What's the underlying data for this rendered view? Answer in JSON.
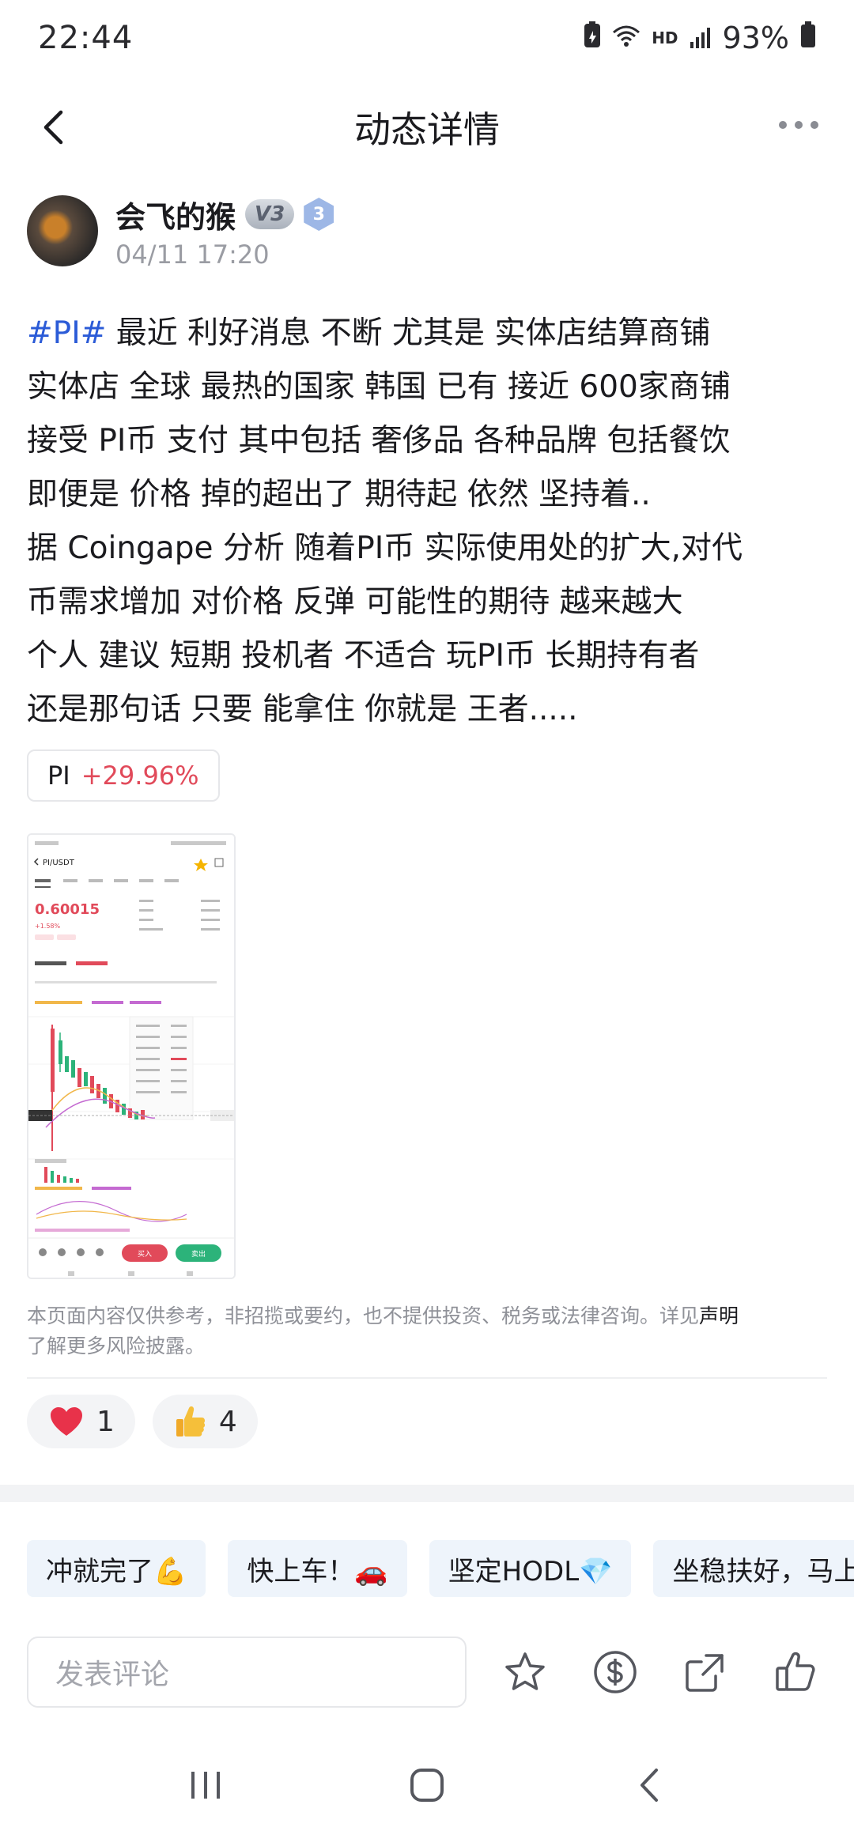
{
  "status_bar": {
    "time": "22:44",
    "network_label": "HD",
    "battery": "93%"
  },
  "header": {
    "title": "动态详情"
  },
  "author": {
    "name": "会飞的猴",
    "vip_badge": "V3",
    "level": "3",
    "time": "04/11 17:20"
  },
  "post": {
    "hashtag": "#PI#",
    "text": " 最近 利好消息 不断 尤其是 实体店结算商铺\n实体店 全球 最热的国家 韩国 已有 接近 600家商铺\n接受 PI币 支付 其中包括 奢侈品 各种品牌 包括餐饮\n即便是 价格 掉的超出了 期待起 依然 坚持着..\n据 Coingape 分析 随着PI币 实际使用处的扩大,对代\n币需求增加 对价格 反弹 可能性的期待 越来越大\n个人 建议 短期 投机者 不适合 玩PI币 长期持有者\n还是那句话 只要 能拿住 你就是 王者.....",
    "coin_tag": {
      "symbol": "PI",
      "change": "+29.96%"
    }
  },
  "thumbnail": {
    "pair": "PI/USDT",
    "price": "0.60015",
    "change": "+1.58%",
    "buy_label": "买入",
    "sell_label": "卖出"
  },
  "disclaimer": {
    "text": "本页面内容仅供参考，非招揽或要约，也不提供投资、税务或法律咨询。详见",
    "link": "声明",
    "suffix": "了解更多风险披露。"
  },
  "reactions": {
    "heart_count": "1",
    "thumbs_count": "4"
  },
  "quick_replies": [
    "冲就完了💪",
    "快上车！🚗",
    "坚定HODL💎",
    "坐稳扶好，马上"
  ],
  "comment": {
    "placeholder": "发表评论"
  },
  "colors": {
    "hashtag": "#2b5bd7",
    "positive_change": "#e14a5a",
    "chip_bg": "#eef4fb"
  }
}
